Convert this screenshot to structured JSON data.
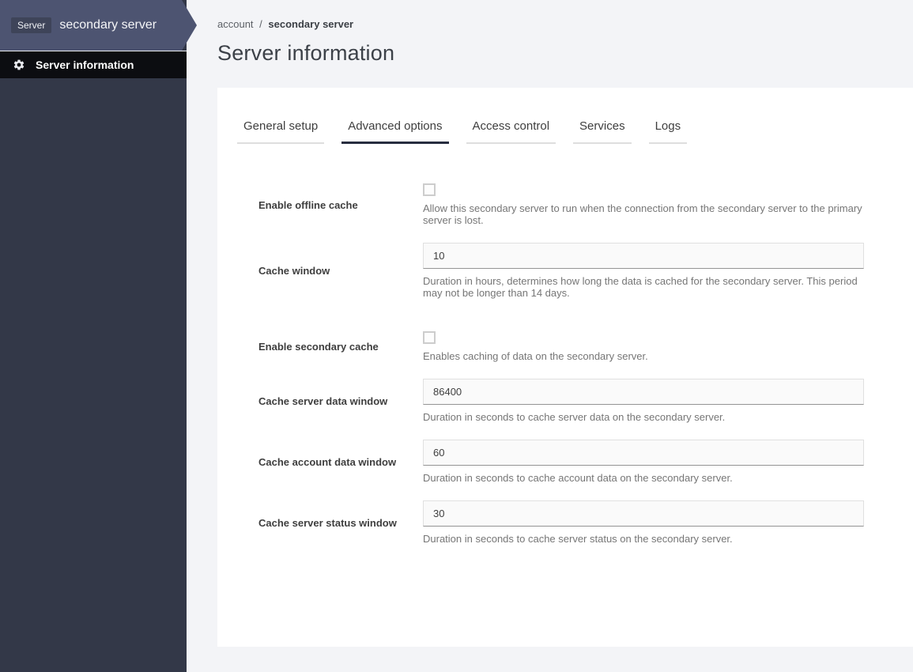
{
  "sidebar": {
    "badge": "Server",
    "server_name": "secondary server",
    "nav": [
      {
        "label": "Server information",
        "icon": "gear-icon",
        "active": true
      }
    ]
  },
  "breadcrumb": {
    "parent": "account",
    "separator": "/",
    "current": "secondary server"
  },
  "page": {
    "title": "Server information"
  },
  "tabs": [
    {
      "label": "General setup",
      "active": false
    },
    {
      "label": "Advanced options",
      "active": true
    },
    {
      "label": "Access control",
      "active": false
    },
    {
      "label": "Services",
      "active": false
    },
    {
      "label": "Logs",
      "active": false
    }
  ],
  "form": {
    "fields": [
      {
        "type": "checkbox",
        "label": "Enable offline cache",
        "checked": false,
        "help": "Allow this secondary server to run when the connection from the secondary server to the primary server is lost."
      },
      {
        "type": "text",
        "label": "Cache window",
        "value": "10",
        "help": "Duration in hours, determines how long the data is cached for the secondary server. This period may not be longer than 14 days."
      },
      {
        "type": "checkbox",
        "label": "Enable secondary cache",
        "checked": false,
        "section_gap": true,
        "help": "Enables caching of data on the secondary server."
      },
      {
        "type": "text",
        "label": "Cache server data window",
        "value": "86400",
        "help": "Duration in seconds to cache server data on the secondary server."
      },
      {
        "type": "text",
        "label": "Cache account data window",
        "value": "60",
        "help": "Duration in seconds to cache account data on the secondary server."
      },
      {
        "type": "text",
        "label": "Cache server status window",
        "value": "30",
        "help": "Duration in seconds to cache server status on the secondary server."
      }
    ]
  },
  "colors": {
    "sidebar_body": "#333848",
    "sidebar_header": "#4d5471",
    "sidebar_badge": "#3e4459",
    "nav_item_bg": "#0c0d11",
    "main_bg": "#f3f4f7",
    "card_bg": "#ffffff",
    "active_tab_underline": "#272d3f",
    "help_text": "#767676",
    "input_bg": "#fafafa"
  }
}
